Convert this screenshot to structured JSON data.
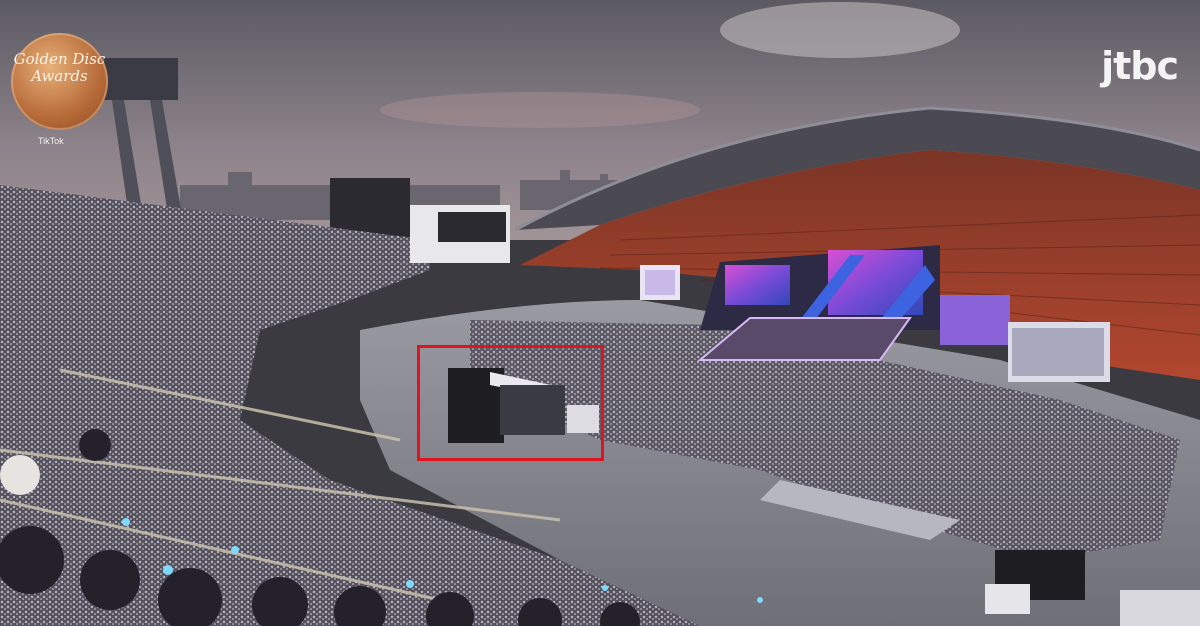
{
  "overlay": {
    "event_logo_text": "Golden Disc Awards",
    "sponsor": "TikTok",
    "broadcaster_logo": "jtbc"
  },
  "highlight_box_color": "#e0141e"
}
